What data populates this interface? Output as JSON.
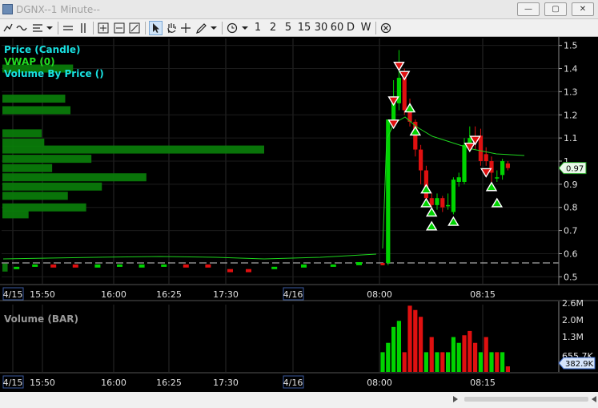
{
  "window": {
    "title": "DGNX--1 Minute--",
    "min_label": "—",
    "max_label": "▢",
    "close_label": "✕"
  },
  "toolbar": {
    "intervals": [
      "1",
      "2",
      "5",
      "15",
      "30",
      "60",
      "D",
      "W"
    ]
  },
  "price_panel": {
    "legend": [
      {
        "label": "Price (Candle)",
        "color": "#19e0e0"
      },
      {
        "label": "VWAP (0)",
        "color": "#22dd22"
      },
      {
        "label": "Volume By Price ()",
        "color": "#19e0e0"
      }
    ],
    "last_price_label": "0.97"
  },
  "volume_panel": {
    "title": "Volume (BAR)",
    "last_volume_label": "382.9K"
  },
  "colors": {
    "up": "#00d400",
    "down": "#e01010",
    "vwap": "#1ed41e",
    "vbp": "#0a7a0a",
    "grid": "#2a2a2a"
  },
  "chart_data": {
    "type": "candlestick",
    "price_axis": {
      "ticks": [
        "1.5",
        "1.4",
        "1.3",
        "1.2",
        "1.1",
        "1",
        "0.9",
        "0.8",
        "0.7",
        "0.6",
        "0.5"
      ],
      "range": [
        0.47,
        1.53
      ]
    },
    "volume_axis": {
      "ticks": [
        "2.6M",
        "2.0M",
        "1.3M",
        "655.7K"
      ],
      "range": [
        0,
        2.6
      ]
    },
    "time_labels": [
      {
        "label": "4/15",
        "boxed": true
      },
      {
        "label": "15:50",
        "boxed": false
      },
      {
        "label": "16:00",
        "boxed": false
      },
      {
        "label": "16:25",
        "boxed": false
      },
      {
        "label": "17:30",
        "boxed": false
      },
      {
        "label": "4/16",
        "boxed": true
      },
      {
        "label": "08:00",
        "boxed": false
      },
      {
        "label": "08:15",
        "boxed": false
      }
    ],
    "reference_line": 0.56,
    "volume_by_price": [
      {
        "price": 1.4,
        "size": 0.27
      },
      {
        "price": 1.27,
        "size": 0.24
      },
      {
        "price": 1.22,
        "size": 0.26
      },
      {
        "price": 1.12,
        "size": 0.15
      },
      {
        "price": 1.08,
        "size": 0.16
      },
      {
        "price": 1.05,
        "size": 1.0
      },
      {
        "price": 1.01,
        "size": 0.34
      },
      {
        "price": 0.97,
        "size": 0.19
      },
      {
        "price": 0.93,
        "size": 0.55
      },
      {
        "price": 0.89,
        "size": 0.38
      },
      {
        "price": 0.85,
        "size": 0.25
      },
      {
        "price": 0.8,
        "size": 0.32
      },
      {
        "price": 0.77,
        "size": 0.1
      },
      {
        "price": 0.54,
        "size": 0.02
      }
    ],
    "candles": [
      {
        "o": 0.56,
        "h": 0.56,
        "c": 0.55,
        "l": 0.55
      },
      {
        "o": 0.56,
        "h": 1.18,
        "c": 1.18,
        "l": 0.55
      },
      {
        "o": 1.18,
        "h": 1.35,
        "c": 1.28,
        "l": 1.17
      },
      {
        "o": 1.25,
        "h": 1.48,
        "c": 1.36,
        "l": 1.22
      },
      {
        "o": 1.36,
        "h": 1.4,
        "c": 1.22,
        "l": 1.2
      },
      {
        "o": 1.22,
        "h": 1.27,
        "c": 1.17,
        "l": 1.15
      },
      {
        "o": 1.17,
        "h": 1.18,
        "c": 1.05,
        "l": 1.02
      },
      {
        "o": 1.05,
        "h": 1.07,
        "c": 0.96,
        "l": 0.9
      },
      {
        "o": 0.96,
        "h": 0.98,
        "c": 0.84,
        "l": 0.81
      },
      {
        "o": 0.84,
        "h": 0.86,
        "c": 0.81,
        "l": 0.78
      },
      {
        "o": 0.81,
        "h": 0.86,
        "c": 0.84,
        "l": 0.79
      },
      {
        "o": 0.84,
        "h": 0.85,
        "c": 0.8,
        "l": 0.78
      },
      {
        "o": 0.81,
        "h": 0.86,
        "c": 0.81,
        "l": 0.79
      },
      {
        "o": 0.78,
        "h": 0.93,
        "c": 0.92,
        "l": 0.77
      },
      {
        "o": 0.91,
        "h": 0.95,
        "c": 0.93,
        "l": 0.89
      },
      {
        "o": 0.91,
        "h": 1.1,
        "c": 1.07,
        "l": 0.9
      },
      {
        "o": 1.07,
        "h": 1.15,
        "c": 1.1,
        "l": 1.04
      },
      {
        "o": 1.1,
        "h": 1.15,
        "c": 1.08,
        "l": 1.05
      },
      {
        "o": 1.11,
        "h": 1.14,
        "c": 1.0,
        "l": 0.98
      },
      {
        "o": 1.03,
        "h": 1.06,
        "c": 1.0,
        "l": 0.98
      },
      {
        "o": 1.0,
        "h": 1.02,
        "c": 0.95,
        "l": 0.88
      },
      {
        "o": 0.93,
        "h": 0.96,
        "c": 0.93,
        "l": 0.91
      },
      {
        "o": 0.94,
        "h": 1.01,
        "c": 1.0,
        "l": 0.92
      },
      {
        "o": 0.99,
        "h": 1.0,
        "c": 0.97,
        "l": 0.96
      }
    ],
    "signals": [
      {
        "i": 3,
        "dir": "down",
        "price": 1.41
      },
      {
        "i": 4,
        "dir": "down",
        "price": 1.37
      },
      {
        "i": 2,
        "dir": "down",
        "price": 1.26
      },
      {
        "i": 5,
        "dir": "up",
        "price": 1.23
      },
      {
        "i": 2,
        "dir": "down",
        "price": 1.16
      },
      {
        "i": 6,
        "dir": "up",
        "price": 1.13
      },
      {
        "i": 8,
        "dir": "up",
        "price": 0.88
      },
      {
        "i": 8,
        "dir": "up",
        "price": 0.82
      },
      {
        "i": 9,
        "dir": "up",
        "price": 0.78
      },
      {
        "i": 9,
        "dir": "up",
        "price": 0.72
      },
      {
        "i": 13,
        "dir": "up",
        "price": 0.74
      },
      {
        "i": 16,
        "dir": "down",
        "price": 1.06
      },
      {
        "i": 17,
        "dir": "down",
        "price": 1.09
      },
      {
        "i": 19,
        "dir": "down",
        "price": 0.95
      },
      {
        "i": 20,
        "dir": "up",
        "price": 0.89
      },
      {
        "i": 21,
        "dir": "up",
        "price": 0.82
      }
    ],
    "volume_bars": [
      {
        "v": 0.78,
        "dir": "up"
      },
      {
        "v": 1.15,
        "dir": "up"
      },
      {
        "v": 1.78,
        "dir": "up"
      },
      {
        "v": 2.02,
        "dir": "up"
      },
      {
        "v": 0.78,
        "dir": "down"
      },
      {
        "v": 2.62,
        "dir": "down"
      },
      {
        "v": 2.45,
        "dir": "down"
      },
      {
        "v": 2.18,
        "dir": "down"
      },
      {
        "v": 0.78,
        "dir": "up"
      },
      {
        "v": 1.38,
        "dir": "down"
      },
      {
        "v": 0.78,
        "dir": "up"
      },
      {
        "v": 0.78,
        "dir": "down"
      },
      {
        "v": 0.78,
        "dir": "up"
      },
      {
        "v": 1.38,
        "dir": "up"
      },
      {
        "v": 1.15,
        "dir": "up"
      },
      {
        "v": 1.45,
        "dir": "down"
      },
      {
        "v": 1.62,
        "dir": "down"
      },
      {
        "v": 1.15,
        "dir": "down"
      },
      {
        "v": 0.78,
        "dir": "up"
      },
      {
        "v": 1.38,
        "dir": "down"
      },
      {
        "v": 0.78,
        "dir": "up"
      },
      {
        "v": 0.78,
        "dir": "down"
      },
      {
        "v": 0.78,
        "dir": "up"
      },
      {
        "v": 0.22,
        "dir": "down"
      }
    ],
    "overnight_bars": [
      {
        "t": 0.02,
        "o": 0.54,
        "c": 0.54
      },
      {
        "t": 0.07,
        "o": 0.55,
        "c": 0.55
      },
      {
        "t": 0.12,
        "o": 0.55,
        "c": 0.54
      },
      {
        "t": 0.18,
        "o": 0.55,
        "c": 0.54
      },
      {
        "t": 0.24,
        "o": 0.54,
        "c": 0.55
      },
      {
        "t": 0.3,
        "o": 0.55,
        "c": 0.55
      },
      {
        "t": 0.36,
        "o": 0.54,
        "c": 0.55
      },
      {
        "t": 0.42,
        "o": 0.55,
        "c": 0.55
      },
      {
        "t": 0.48,
        "o": 0.55,
        "c": 0.54
      },
      {
        "t": 0.54,
        "o": 0.55,
        "c": 0.54
      },
      {
        "t": 0.6,
        "o": 0.53,
        "c": 0.52
      },
      {
        "t": 0.65,
        "o": 0.53,
        "c": 0.52
      },
      {
        "t": 0.72,
        "o": 0.54,
        "c": 0.54
      },
      {
        "t": 0.8,
        "o": 0.54,
        "c": 0.55
      },
      {
        "t": 0.88,
        "o": 0.55,
        "c": 0.55
      },
      {
        "t": 0.95,
        "o": 0.55,
        "c": 0.56
      }
    ]
  }
}
